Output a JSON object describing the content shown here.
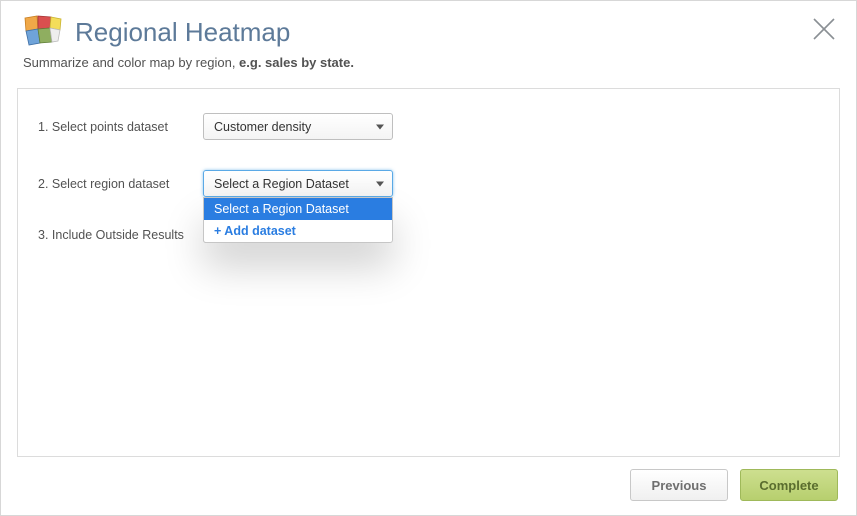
{
  "header": {
    "title": "Regional Heatmap",
    "subtitle_prefix": "Summarize and color map by region, ",
    "subtitle_bold": "e.g. sales by state."
  },
  "form": {
    "row1": {
      "label": "1. Select points dataset",
      "selected": "Customer density"
    },
    "row2": {
      "label": "2. Select region dataset",
      "selected": "Select a Region Dataset",
      "options": [
        {
          "label": "Select a Region Dataset",
          "selected": true,
          "add": false
        },
        {
          "label": "+ Add dataset",
          "selected": false,
          "add": true
        }
      ]
    },
    "row3": {
      "label": "3. Include Outside Results",
      "checked": false
    }
  },
  "footer": {
    "previous": "Previous",
    "complete": "Complete"
  }
}
